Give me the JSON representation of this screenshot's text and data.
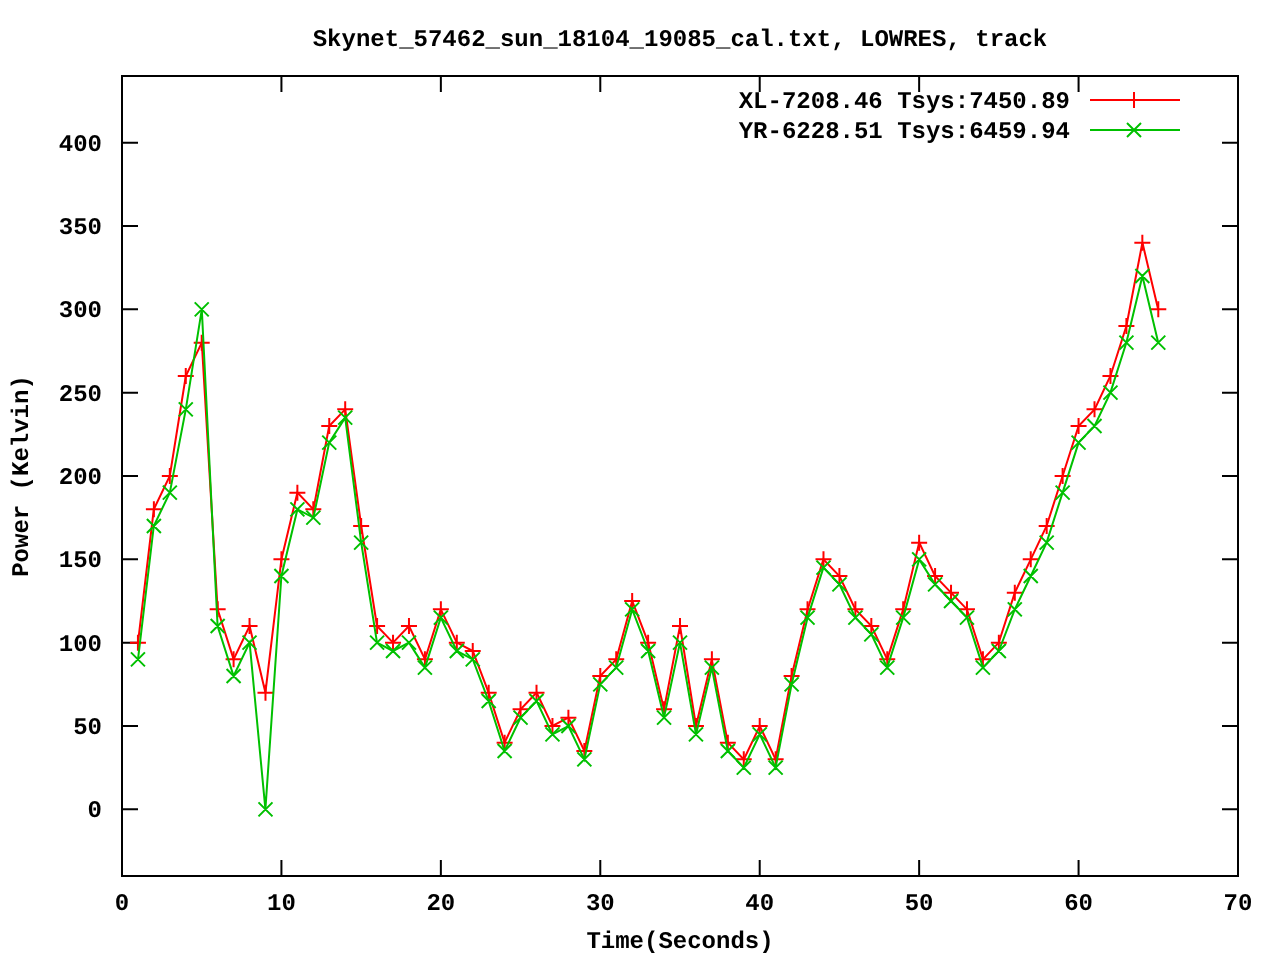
{
  "chart_data": {
    "type": "line",
    "title": "Skynet_57462_sun_18104_19085_cal.txt, LOWRES, track",
    "xlabel": "Time(Seconds)",
    "ylabel": "Power (Kelvin)",
    "x": [
      1,
      2,
      3,
      4,
      5,
      6,
      7,
      8,
      9,
      10,
      11,
      12,
      13,
      14,
      15,
      16,
      17,
      18,
      19,
      20,
      21,
      22,
      23,
      24,
      25,
      26,
      27,
      28,
      29,
      30,
      31,
      32,
      33,
      34,
      35,
      36,
      37,
      38,
      39,
      40,
      41,
      42,
      43,
      44,
      45,
      46,
      47,
      48,
      49,
      50,
      51,
      52,
      53,
      54,
      55,
      56,
      57,
      58,
      59,
      60,
      61,
      62,
      63,
      64,
      65
    ],
    "series": [
      {
        "name": "XL-7208.46 Tsys:7450.89",
        "color": "#ff0000",
        "marker": "plus",
        "values": [
          100,
          180,
          200,
          260,
          280,
          120,
          90,
          110,
          70,
          150,
          190,
          180,
          230,
          240,
          170,
          110,
          100,
          110,
          90,
          120,
          100,
          95,
          70,
          40,
          60,
          70,
          50,
          55,
          35,
          80,
          90,
          125,
          100,
          60,
          110,
          50,
          90,
          40,
          30,
          50,
          30,
          80,
          120,
          150,
          140,
          120,
          110,
          90,
          120,
          160,
          140,
          130,
          120,
          90,
          100,
          130,
          150,
          170,
          200,
          230,
          240,
          260,
          290,
          340,
          300
        ]
      },
      {
        "name": "YR-6228.51 Tsys:6459.94",
        "color": "#00c000",
        "marker": "cross",
        "values": [
          90,
          170,
          190,
          240,
          300,
          110,
          80,
          100,
          0,
          140,
          180,
          175,
          220,
          235,
          160,
          100,
          95,
          100,
          85,
          115,
          95,
          90,
          65,
          35,
          55,
          65,
          45,
          50,
          30,
          75,
          85,
          120,
          95,
          55,
          100,
          45,
          85,
          35,
          25,
          45,
          25,
          75,
          115,
          145,
          135,
          115,
          105,
          85,
          115,
          150,
          135,
          125,
          115,
          85,
          95,
          120,
          140,
          160,
          190,
          220,
          230,
          250,
          280,
          320,
          280
        ]
      }
    ],
    "legend": true,
    "xlim": [
      0,
      70
    ],
    "ylim": [
      -40,
      440
    ],
    "xticks": [
      0,
      10,
      20,
      30,
      40,
      50,
      60,
      70
    ],
    "yticks": [
      0,
      50,
      100,
      150,
      200,
      250,
      300,
      350,
      400
    ]
  }
}
